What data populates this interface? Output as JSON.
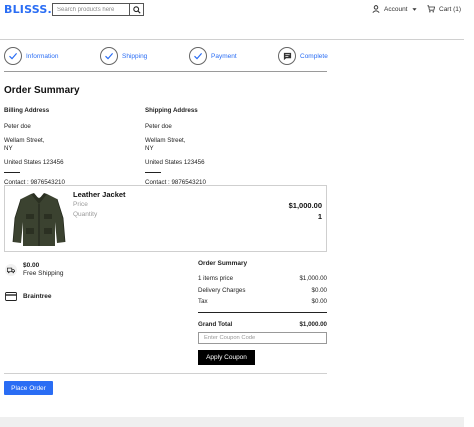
{
  "header": {
    "logo": "BLISSS",
    "logo_dot": ".",
    "search_placeholder": "Search products here",
    "account_label": "Account",
    "cart_label": "Cart (1)"
  },
  "steps": [
    {
      "label": "Information",
      "icon": "check-icon"
    },
    {
      "label": "Shipping",
      "icon": "check-icon"
    },
    {
      "label": "Payment",
      "icon": "check-icon"
    },
    {
      "label": "Complete",
      "icon": "message-icon"
    }
  ],
  "order_title": "Order Summary",
  "billing": {
    "heading": "Billing Address",
    "name": "Peter doe",
    "street": "Wellam Street,",
    "state": "NY",
    "country_zip": "United States 123456",
    "contact": "Contact : 9876543210"
  },
  "shipping": {
    "heading": "Shipping Address",
    "name": "Peter doe",
    "street": "Wellam Street,",
    "state": "NY",
    "country_zip": "United States 123456",
    "contact": "Contact : 9876543210"
  },
  "product": {
    "name": "Leather Jacket",
    "price_label": "Price",
    "quantity_label": "Quantity",
    "price": "$1,000.00",
    "quantity": "1"
  },
  "shipping_method": {
    "amount": "$0.00",
    "label": "Free Shipping"
  },
  "payment_method": {
    "label": "Braintree"
  },
  "summary": {
    "heading": "Order Summary",
    "rows": [
      {
        "label": "1 items price",
        "value": "$1,000.00"
      },
      {
        "label": "Delivery Charges",
        "value": "$0.00"
      },
      {
        "label": "Tax",
        "value": "$0.00"
      }
    ],
    "grand_total_label": "Grand Total",
    "grand_total_value": "$1,000.00",
    "coupon_placeholder": "Enter Coupon Code",
    "apply_label": "Apply Coupon"
  },
  "place_order_label": "Place Order",
  "colors": {
    "accent": "#2a6df4"
  }
}
